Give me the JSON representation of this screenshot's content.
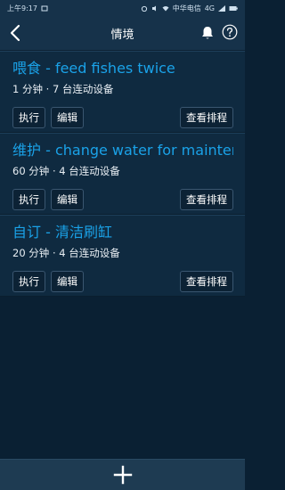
{
  "status": {
    "time": "上午9:17",
    "carrier": "中华电信",
    "network": "4G"
  },
  "header": {
    "title": "情境"
  },
  "scenes": [
    {
      "title": "喂食 - feed fishes twice",
      "subtitle": "1 分钟 · 7 台连动设备",
      "run_label": "执行",
      "edit_label": "编辑",
      "schedule_label": "查看排程"
    },
    {
      "title": "维护 - change water for maintenance",
      "subtitle": "60 分钟 · 4 台连动设备",
      "run_label": "执行",
      "edit_label": "编辑",
      "schedule_label": "查看排程"
    },
    {
      "title": "自订 - 清洁刷缸",
      "subtitle": "20 分钟 · 4 台连动设备",
      "run_label": "执行",
      "edit_label": "编辑",
      "schedule_label": "查看排程"
    }
  ],
  "colors": {
    "accent": "#1aa2e8",
    "background": "#0a2033",
    "card": "#0f2a40"
  }
}
